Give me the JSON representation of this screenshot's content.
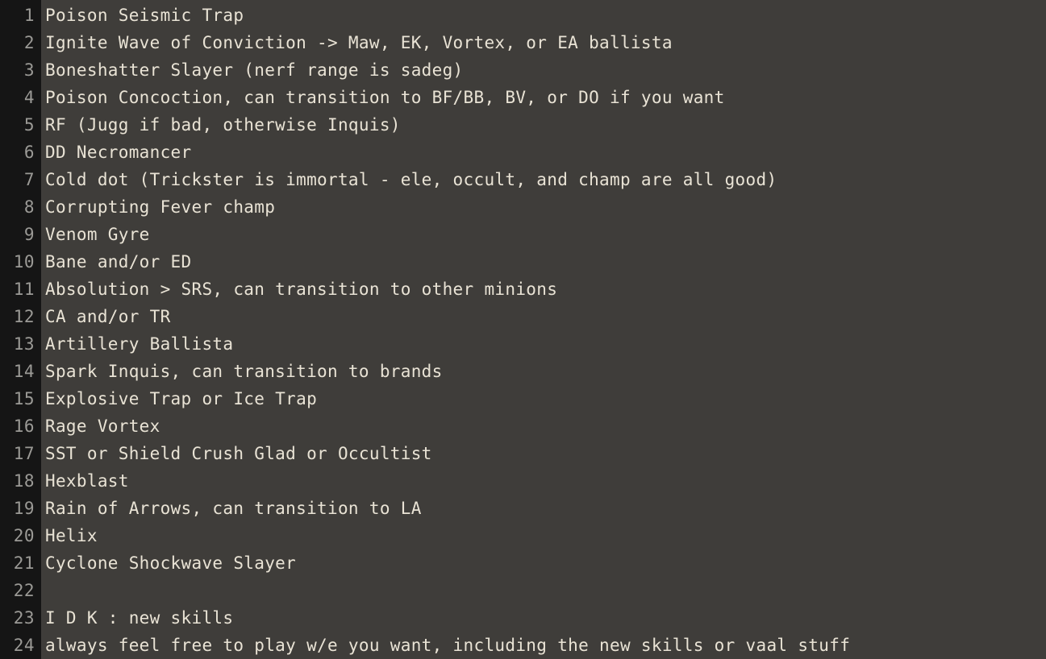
{
  "editor": {
    "background_color": "#3f3d3a",
    "gutter_color": "#151515",
    "text_color": "#e9e3d5",
    "line_number_color": "#9b9a96",
    "total_lines": 24
  },
  "lines": [
    {
      "number": "1",
      "text": "Poison Seismic Trap"
    },
    {
      "number": "2",
      "text": "Ignite Wave of Conviction -> Maw, EK, Vortex, or EA ballista"
    },
    {
      "number": "3",
      "text": "Boneshatter Slayer (nerf range is sadeg)"
    },
    {
      "number": "4",
      "text": "Poison Concoction, can transition to BF/BB, BV, or DO if you want"
    },
    {
      "number": "5",
      "text": "RF (Jugg if bad, otherwise Inquis)"
    },
    {
      "number": "6",
      "text": "DD Necromancer"
    },
    {
      "number": "7",
      "text": "Cold dot (Trickster is immortal - ele, occult, and champ are all good)"
    },
    {
      "number": "8",
      "text": "Corrupting Fever champ"
    },
    {
      "number": "9",
      "text": "Venom Gyre"
    },
    {
      "number": "10",
      "text": "Bane and/or ED"
    },
    {
      "number": "11",
      "text": "Absolution > SRS, can transition to other minions"
    },
    {
      "number": "12",
      "text": "CA and/or TR"
    },
    {
      "number": "13",
      "text": "Artillery Ballista"
    },
    {
      "number": "14",
      "text": "Spark Inquis, can transition to brands"
    },
    {
      "number": "15",
      "text": "Explosive Trap or Ice Trap"
    },
    {
      "number": "16",
      "text": "Rage Vortex"
    },
    {
      "number": "17",
      "text": "SST or Shield Crush Glad or Occultist"
    },
    {
      "number": "18",
      "text": "Hexblast"
    },
    {
      "number": "19",
      "text": "Rain of Arrows, can transition to LA"
    },
    {
      "number": "20",
      "text": "Helix"
    },
    {
      "number": "21",
      "text": "Cyclone Shockwave Slayer"
    },
    {
      "number": "22",
      "text": ""
    },
    {
      "number": "23",
      "text": "I D K : new skills"
    },
    {
      "number": "24",
      "text": "always feel free to play w/e you want, including the new skills or vaal stuff"
    }
  ]
}
